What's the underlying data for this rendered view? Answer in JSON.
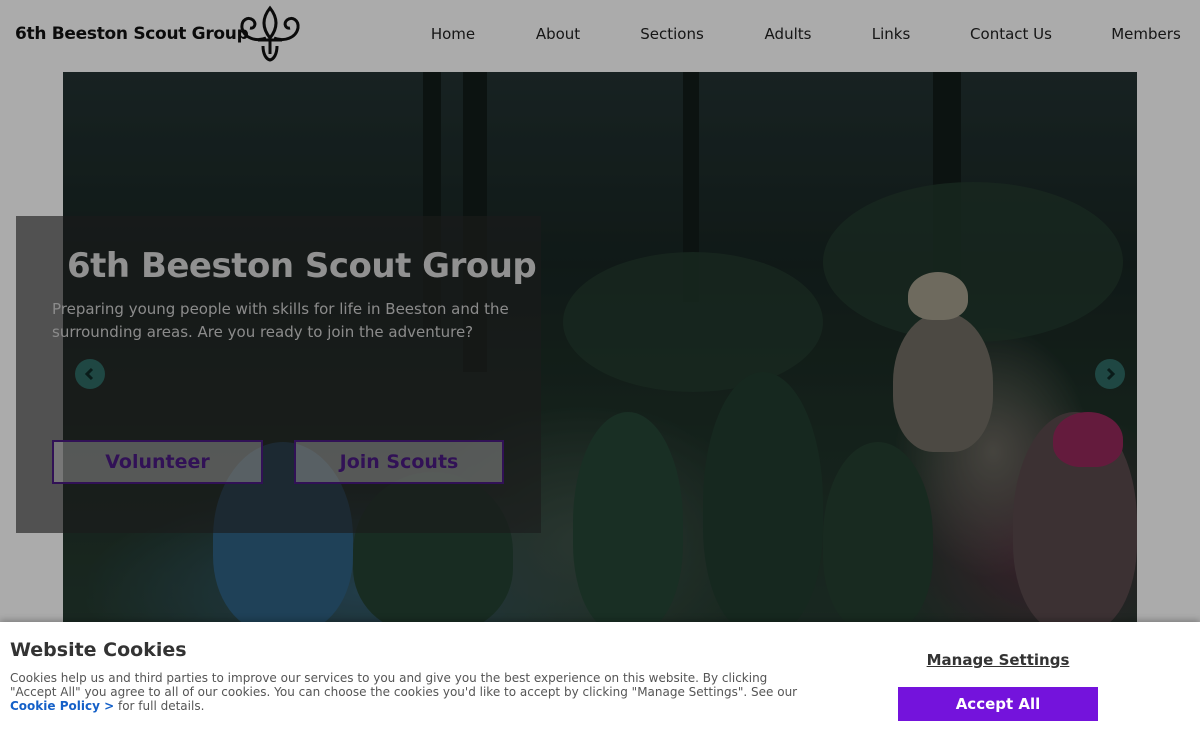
{
  "header": {
    "site_title": "6th Beeston Scout Group",
    "logo_icon": "fleur-de-lis-icon",
    "nav": [
      "Home",
      "About",
      "Sections",
      "Adults",
      "Links",
      "Contact Us",
      "Members"
    ]
  },
  "hero": {
    "title": "6th Beeston Scout Group",
    "subtitle": "Preparing young people with skills for life in Beeston and the surrounding areas. Are you ready to join the adventure?",
    "buttons": [
      "Volunteer",
      "Join Scouts"
    ],
    "prev_icon": "chevron-left-icon",
    "next_icon": "chevron-right-icon"
  },
  "cookies": {
    "title": "Website Cookies",
    "text": "Cookies help us and third parties to improve our services to you and give you the best experience on this website. By clicking \"Accept All\" you agree to all of our cookies. You can choose the cookies you'd like to accept by clicking \"Manage Settings\". See our",
    "link": "Cookie Policy >",
    "text_after": "for full details.",
    "manage": "Manage Settings",
    "accept": "Accept All"
  },
  "colors": {
    "brand_purple": "#7413dc",
    "button_border": "#4a1a80",
    "arrow_teal": "#2f6b64"
  }
}
